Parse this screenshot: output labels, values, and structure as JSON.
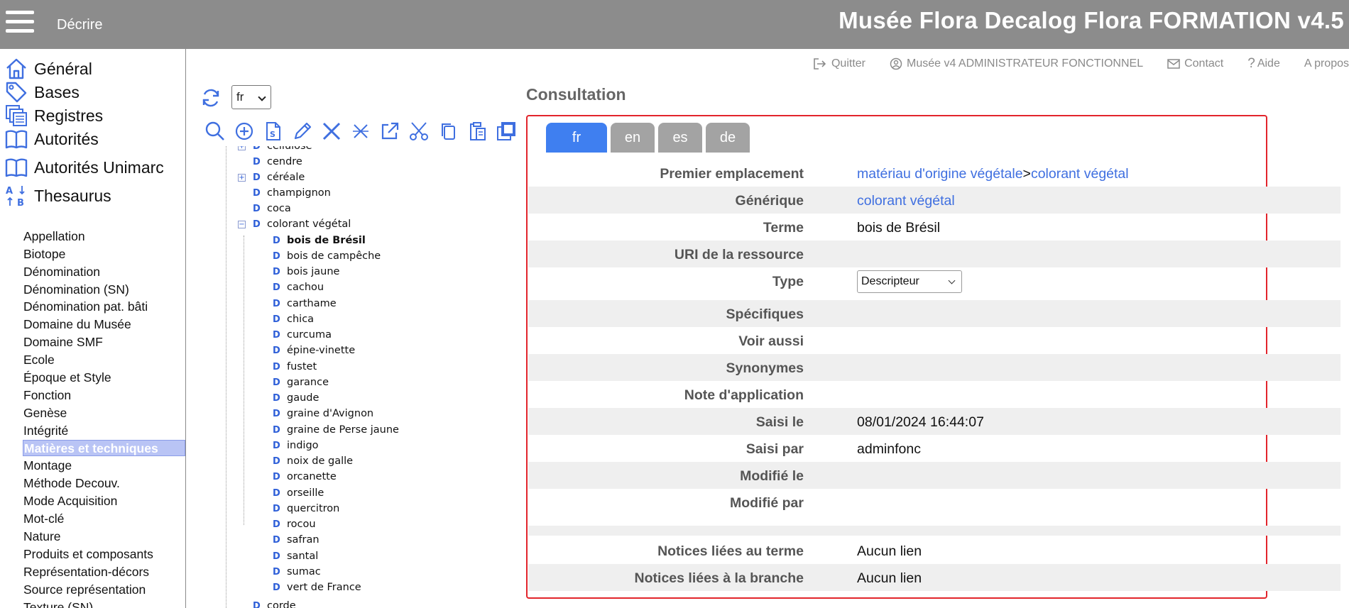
{
  "header": {
    "section": "Décrire",
    "title": "Musée Flora Decalog Flora FORMATION v4.5"
  },
  "sidebar": {
    "main_items": [
      {
        "label": "Général",
        "icon": "home-icon"
      },
      {
        "label": "Bases",
        "icon": "tag-icon"
      },
      {
        "label": "Registres",
        "icon": "registers-icon"
      },
      {
        "label": "Autorités",
        "icon": "book-icon"
      },
      {
        "label": "Autorités Unimarc",
        "icon": "book-icon"
      },
      {
        "label": "Thesaurus",
        "icon": "sort-az-icon"
      }
    ],
    "sub_items": [
      "Appellation",
      "Biotope",
      "Dénomination",
      "Dénomination (SN)",
      "Dénomination pat. bâti",
      "Domaine du Musée",
      "Domaine SMF",
      "Ecole",
      "Époque et Style",
      "Fonction",
      "Genèse",
      "Intégrité",
      "Matières et techniques",
      "Montage",
      "Méthode Decouv.",
      "Mode Acquisition",
      "Mot-clé",
      "Nature",
      "Produits et composants",
      "Représentation-décors",
      "Source représentation",
      "Texture (SN)"
    ],
    "selected": "Matières et techniques"
  },
  "toplinks": [
    {
      "label": "Quitter",
      "icon": "logout-icon"
    },
    {
      "label": "Musée v4 ADMINISTRATEUR FONCTIONNEL",
      "icon": "user-circle-icon"
    },
    {
      "label": "Contact",
      "icon": "envelope-icon"
    },
    {
      "label": "Aide",
      "icon": "question-icon"
    },
    {
      "label": "A propos",
      "icon": ""
    }
  ],
  "tree_panel": {
    "language": "fr",
    "tools": [
      "search-icon",
      "add-circle-icon",
      "new-document-icon",
      "edit-pencil-icon",
      "delete-x-icon",
      "cut-x-icon",
      "external-link-icon",
      "scissors-icon",
      "copy-icon",
      "paste-icon",
      "duplicate-icon"
    ],
    "nodes_top": [
      {
        "label": "cellulose",
        "toggle": "+"
      },
      {
        "label": "cendre",
        "toggle": ""
      },
      {
        "label": "céréale",
        "toggle": "+"
      },
      {
        "label": "champignon",
        "toggle": ""
      },
      {
        "label": "coca",
        "toggle": ""
      },
      {
        "label": "colorant végétal",
        "toggle": "−"
      }
    ],
    "children": [
      "bois de Brésil",
      "bois de campêche",
      "bois jaune",
      "cachou",
      "carthame",
      "chica",
      "curcuma",
      "épine-vinette",
      "fustet",
      "garance",
      "gaude",
      "graine d'Avignon",
      "graine de Perse jaune",
      "indigo",
      "noix de galle",
      "orcanette",
      "orseille",
      "quercitron",
      "rocou",
      "safran",
      "santal",
      "sumac",
      "vert de France"
    ],
    "selected_child": "bois de Brésil",
    "nodes_bottom": [
      "corde"
    ]
  },
  "consultation": {
    "title": "Consultation",
    "tabs": [
      "fr",
      "en",
      "es",
      "de"
    ],
    "active_tab": "fr",
    "fields": {
      "premier_emplacement": {
        "label": "Premier emplacement",
        "link1": "matériau d'origine végétale",
        "sep": ">",
        "link2": "colorant végétal"
      },
      "generique": {
        "label": "Générique",
        "link": "colorant végétal"
      },
      "terme": {
        "label": "Terme",
        "value": "bois de Brésil"
      },
      "uri": {
        "label": "URI de la ressource",
        "value": ""
      },
      "type": {
        "label": "Type",
        "value": "Descripteur"
      },
      "specifiques": {
        "label": "Spécifiques",
        "value": ""
      },
      "voir_aussi": {
        "label": "Voir aussi",
        "value": ""
      },
      "synonymes": {
        "label": "Synonymes",
        "value": ""
      },
      "note": {
        "label": "Note d'application",
        "value": ""
      },
      "saisi_le": {
        "label": "Saisi le",
        "value": "08/01/2024 16:44:07"
      },
      "saisi_par": {
        "label": "Saisi par",
        "value": "adminfonc"
      },
      "modifie_le": {
        "label": "Modifié le",
        "value": ""
      },
      "modifie_par": {
        "label": "Modifié par",
        "value": ""
      },
      "notices_terme": {
        "label": "Notices liées au terme",
        "value": "Aucun lien"
      },
      "notices_branche": {
        "label": "Notices liées à la branche",
        "value": "Aucun lien"
      }
    }
  },
  "colors": {
    "header_bg": "#8c8c8c",
    "accent_blue": "#3f7ff0",
    "link_blue": "#3f6fe0",
    "panel_border": "#e2252c",
    "selected_bg": "#b9c4f5"
  }
}
